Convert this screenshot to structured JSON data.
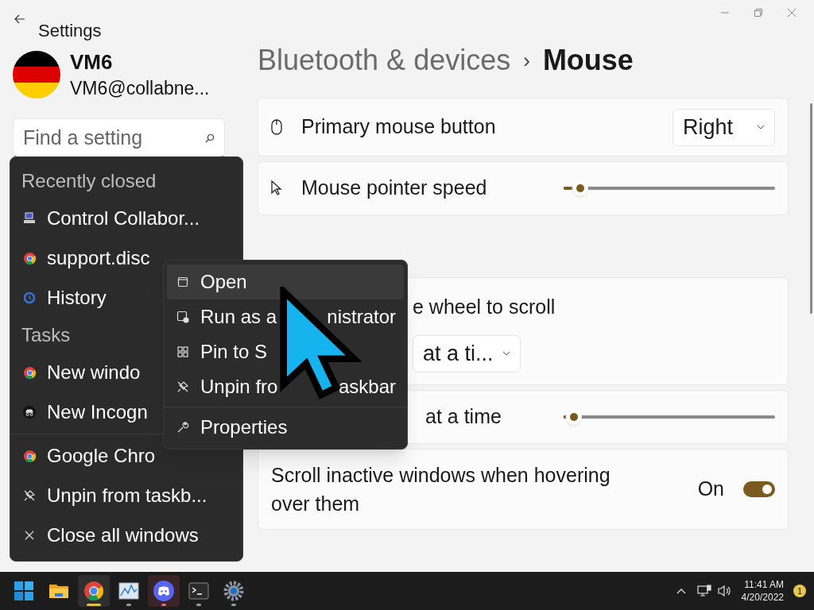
{
  "window": {
    "title": "Settings"
  },
  "account": {
    "name": "VM6",
    "email": "VM6@collabne..."
  },
  "search": {
    "placeholder": "Find a setting"
  },
  "breadcrumb": {
    "parent": "Bluetooth & devices",
    "separator": "›",
    "current": "Mouse"
  },
  "settings": [
    {
      "kind": "dropdown",
      "label": "Primary mouse button",
      "value": "Right"
    },
    {
      "kind": "slider",
      "label": "Mouse pointer speed",
      "level": 0.08
    },
    {
      "kind": "dropdown-below",
      "label": "e wheel to scroll",
      "value": "at a ti..."
    },
    {
      "kind": "slider",
      "label": "at a time",
      "level": 0.05
    },
    {
      "kind": "toggle",
      "label": "Scroll inactive windows when hovering over them",
      "state": "On",
      "on": true
    }
  ],
  "jump_list": {
    "sections": [
      {
        "title": "Recently closed",
        "items": [
          {
            "kind": "app",
            "label": "Control Collabor..."
          },
          {
            "kind": "chrome",
            "label": "support.disc"
          },
          {
            "kind": "history",
            "label": "History"
          }
        ]
      },
      {
        "title": "Tasks",
        "items": [
          {
            "kind": "chrome",
            "label": "New windo"
          },
          {
            "kind": "incognito",
            "label": "New Incogn"
          }
        ]
      },
      {
        "items": [
          {
            "kind": "chrome",
            "label": "Google Chro"
          },
          {
            "kind": "unpin",
            "label": "Unpin from taskb..."
          },
          {
            "kind": "close",
            "label": "Close all windows"
          }
        ]
      }
    ]
  },
  "context_menu": {
    "items": [
      {
        "kind": "open",
        "parts": [
          "Open"
        ],
        "selected": true
      },
      {
        "kind": "admin",
        "parts": [
          "Run as a",
          "nistrator"
        ],
        "selected": false
      },
      {
        "kind": "pin",
        "parts": [
          "Pin to S"
        ],
        "selected": false
      },
      {
        "kind": "unpin",
        "parts": [
          "Unpin fro",
          "askbar"
        ],
        "selected": false
      },
      {
        "kind": "properties",
        "parts": [
          "Properties"
        ],
        "selected": false
      }
    ]
  },
  "taskbar": {
    "apps": [
      {
        "kind": "start",
        "running": false,
        "active": false,
        "attention": false
      },
      {
        "kind": "explorer",
        "running": false,
        "active": false,
        "attention": false
      },
      {
        "kind": "chrome",
        "running": true,
        "active": true,
        "attention": false
      },
      {
        "kind": "monitor",
        "running": true,
        "active": false,
        "attention": false
      },
      {
        "kind": "discord",
        "running": true,
        "active": false,
        "attention": true
      },
      {
        "kind": "terminal",
        "running": true,
        "active": false,
        "attention": false
      },
      {
        "kind": "settings",
        "running": true,
        "active": false,
        "attention": false
      }
    ],
    "clock": {
      "time": "11:41 AM",
      "date": "4/20/2022"
    },
    "notification_count": "1"
  }
}
